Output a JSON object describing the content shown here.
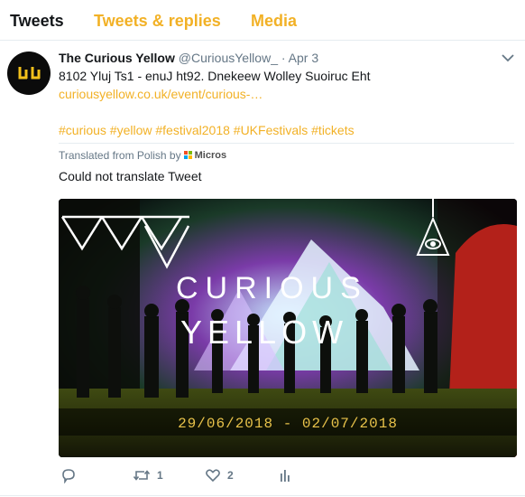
{
  "tabs": [
    {
      "label": "Tweets",
      "active": true
    },
    {
      "label": "Tweets & replies",
      "active": false
    },
    {
      "label": "Media",
      "active": false
    }
  ],
  "colors": {
    "accent": "#f2b126",
    "text": "#14171a",
    "muted": "#657786"
  },
  "tweet": {
    "name": "The Curious Yellow",
    "handle": "@CuriousYellow_",
    "separator": "·",
    "date": "Apr 3",
    "text": "8102 Yluj Ts1 - enuJ ht92. Dnekeew Wolley Suoiruc Eht",
    "link": "curiousyellow.co.uk/event/curious-…",
    "hashtags": "#curious #yellow #festival2018 #UKFestivals #tickets",
    "translated_label": "Translated from Polish by",
    "translator": "Micros",
    "translation_result": "Could not translate Tweet",
    "media": {
      "title_line1": "CURIOUS",
      "title_line2": "YELLOW",
      "dates": "29/06/2018 - 02/07/2018"
    },
    "actions": {
      "reply_icon": "reply-icon",
      "retweet_icon": "retweet-icon",
      "retweet_count": "1",
      "like_icon": "heart-icon",
      "like_count": "2",
      "analytics_icon": "analytics-icon"
    }
  }
}
